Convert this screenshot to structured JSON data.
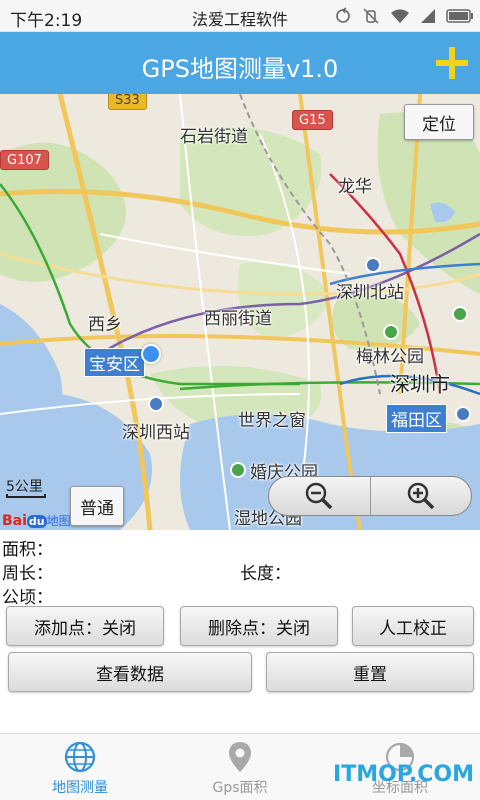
{
  "status_bar": {
    "time": "下午2:19",
    "app_name": "法爱工程软件"
  },
  "title_bar": {
    "title": "GPS地图测量v1.0",
    "add_icon": "plus-icon",
    "accent_color": "#f3d21c",
    "background_color": "#4aa7e4"
  },
  "map": {
    "locate_label": "定位",
    "normal_label": "普通",
    "scale_label": "5公里",
    "logo_text": "Bai",
    "logo_du": "du",
    "logo_map": "地图",
    "road_tags": [
      "S33",
      "G15",
      "G107"
    ],
    "place_labels": {
      "shiyan": "石岩街道",
      "longhua": "龙华",
      "shenzhen_north": "深圳北站",
      "xixiang": "西乡",
      "xili": "西丽街道",
      "meilin": "梅林公园",
      "shenzhen_city": "深圳市",
      "shenzhen_west": "深圳西站",
      "window_world": "世界之窗",
      "yuqing": "婚庆公园",
      "wetland": "湿地公园"
    },
    "district_labels": {
      "baoan": "宝安区",
      "futian": "福田区"
    }
  },
  "info": {
    "area_label": "面积：",
    "perimeter_label": "周长：",
    "length_label": "长度：",
    "hectare_label": "公顷："
  },
  "actions": {
    "add_point": "添加点：关闭",
    "delete_point": "删除点：关闭",
    "manual_calibrate": "人工校正",
    "view_data": "查看数据",
    "reset": "重置"
  },
  "bottom_nav": {
    "items": [
      {
        "label": "地图测量",
        "icon": "globe-icon",
        "active": true
      },
      {
        "label": "Gps面积",
        "icon": "map-pin-icon",
        "active": false
      },
      {
        "label": "坐标面积",
        "icon": "pie-chart-icon",
        "active": false
      }
    ]
  },
  "watermark": "ITMOP.COM"
}
